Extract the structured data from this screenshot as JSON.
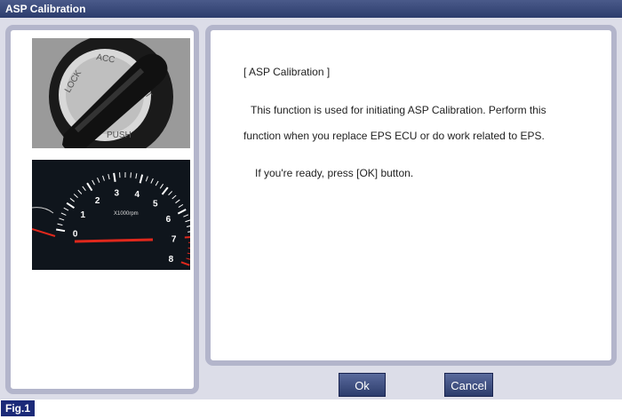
{
  "window": {
    "title": "ASP Calibration"
  },
  "images": {
    "ignition": "ignition-key-photo",
    "tachometer": "tachometer-photo"
  },
  "gauge_labels": [
    "0",
    "1",
    "2",
    "3",
    "4",
    "5",
    "6",
    "7",
    "8"
  ],
  "gauge_unit": "X1000rpm",
  "content": {
    "heading": "[ ASP Calibration ]",
    "line1": "This function is used for initiating ASP Calibration. Perform this",
    "line2": "function when you replace EPS ECU or do work related to EPS.",
    "line3": "If you're ready, press [OK] button."
  },
  "buttons": {
    "ok": "Ok",
    "cancel": "Cancel"
  },
  "figure_label": "Fig.1"
}
